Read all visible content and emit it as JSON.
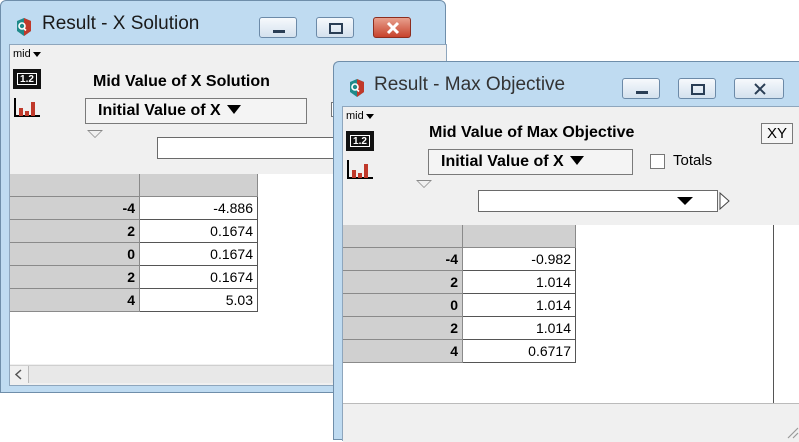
{
  "colors": {
    "frame": "#bfdbf1",
    "client": "#f0f0f0",
    "header_cells": "#d0d0d0",
    "close": "#c7432c"
  },
  "x_window": {
    "title": "Result - X Solution",
    "mid_selector": "mid",
    "table_icon_label": "1.2",
    "heading": "Mid Value of X Solution",
    "index_selector": "Initial Value of X",
    "rows": [
      {
        "index": "-4",
        "value": "-4.886"
      },
      {
        "index": "2",
        "value": "0.1674"
      },
      {
        "index": "0",
        "value": "0.1674"
      },
      {
        "index": "2",
        "value": "0.1674"
      },
      {
        "index": "4",
        "value": "5.03"
      }
    ]
  },
  "obj_window": {
    "title": "Result - Max Objective",
    "mid_selector": "mid",
    "table_icon_label": "1.2",
    "heading": "Mid Value of Max Objective",
    "xy_button": "XY",
    "index_selector": "Initial Value of X",
    "totals_label": "Totals",
    "rows": [
      {
        "index": "-4",
        "value": "-0.982"
      },
      {
        "index": "2",
        "value": "1.014"
      },
      {
        "index": "0",
        "value": "1.014"
      },
      {
        "index": "2",
        "value": "1.014"
      },
      {
        "index": "4",
        "value": "0.6717"
      }
    ]
  }
}
